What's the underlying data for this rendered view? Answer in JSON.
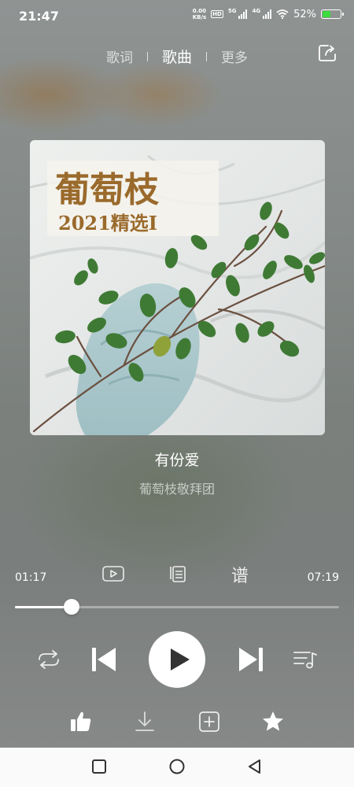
{
  "status_bar": {
    "time": "21:47",
    "net_speed_value": "0.00",
    "net_speed_unit": "KB/s",
    "hd_label": "HD",
    "sim1_label": "5G",
    "sim2_label": "4G",
    "battery_percent": "52%",
    "battery_level": 0.52,
    "battery_color": "#3ddc3d"
  },
  "header": {
    "tabs": [
      {
        "label": "歌词"
      },
      {
        "label": "歌曲"
      },
      {
        "label": "更多"
      }
    ],
    "active_tab": "歌曲",
    "share_icon": "share-icon"
  },
  "album_art": {
    "title": "葡萄枝",
    "subtitle": "2021精选Ⅰ"
  },
  "song": {
    "title": "有份爱",
    "artist": "葡萄枝敬拜团"
  },
  "progress": {
    "current_time": "01:17",
    "total_time": "07:19",
    "fraction": 0.1754
  },
  "middle_actions": [
    {
      "icon": "mv-icon"
    },
    {
      "icon": "copy-icon"
    },
    {
      "label": "谱",
      "icon": "sheet-music-icon"
    }
  ],
  "controls": {
    "repeat_icon": "repeat-icon",
    "prev_icon": "previous-icon",
    "play_icon": "play-icon",
    "next_icon": "next-icon",
    "playlist_icon": "playlist-icon"
  },
  "bottom_actions": [
    "like-icon",
    "download-icon",
    "add-icon",
    "favorite-star-icon"
  ],
  "nav_bar": [
    "recents-square-icon",
    "home-circle-icon",
    "back-triangle-icon"
  ],
  "colors": {
    "accent": "#ffffff",
    "background": "#838886",
    "title_color": "#9a6a2c"
  }
}
